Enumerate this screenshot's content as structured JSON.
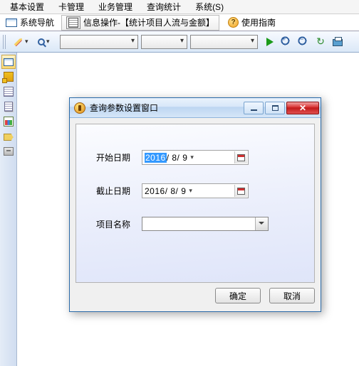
{
  "menubar": {
    "items": [
      "基本设置",
      "卡管理",
      "业务管理",
      "查询统计",
      "系统(S)"
    ]
  },
  "tabbar": {
    "nav_label": "系统导航",
    "tab_label": "信息操作-【统计项目人流与金额】",
    "guide_label": "使用指南"
  },
  "dialog": {
    "title": "查询参数设置窗口",
    "start_label": "开始日期",
    "start_year": "2016",
    "start_rest": "/ 8/ 9",
    "end_label": "截止日期",
    "end_value": "2016/ 8/ 9",
    "project_label": "项目名称",
    "ok_label": "确定",
    "cancel_label": "取消"
  }
}
